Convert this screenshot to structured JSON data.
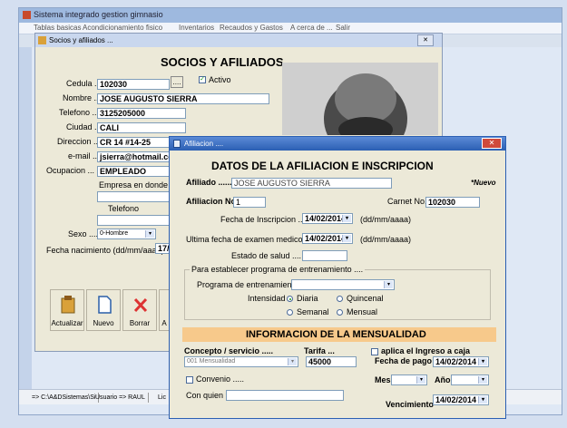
{
  "main_window": {
    "title": "Sistema integrado gestion gimnasio",
    "menu": [
      "Tablas basicas",
      "Acondicionamiento fisico",
      "Inventarios",
      "Recaudos y Gastos",
      "A cerca de ...",
      "Salir"
    ],
    "status": [
      "=> C:\\A&DSistemas\\Si",
      "Usuario => RAUL",
      "Lic"
    ]
  },
  "socios": {
    "title": "Socios y afiliados ...",
    "heading": "SOCIOS Y AFILIADOS",
    "labels": {
      "cedula": "Cedula ...",
      "nombre": "Nombre ...",
      "telefono": "Telefono ...",
      "ciudad": "Ciudad ...",
      "direccion": "Direccion ...",
      "email": "e-mail ...",
      "ocupacion": "Ocupacion ...",
      "empresa": "Empresa en donde labor",
      "telefono2": "Telefono",
      "sexo": "Sexo ....",
      "fecha_nac": "Fecha nacimiento (dd/mm/aaaa)",
      "activo": "Activo",
      "ellipsis": "...."
    },
    "values": {
      "cedula": "102030",
      "nombre": "JOSE AUGUSTO SIERRA",
      "telefono": "3125205000",
      "ciudad": "CALI",
      "direccion": "CR 14 #14-25",
      "email": "jsierra@hotmail.co",
      "ocupacion": "EMPLEADO",
      "sexo": "0-Hombre",
      "fecha_nac": "17/"
    },
    "toolbar": [
      "Actualizar",
      "Nuevo",
      "Borrar",
      "A"
    ]
  },
  "afiliacion": {
    "title": "Afiliacion ....",
    "heading": "DATOS DE LA AFILIACION E INSCRIPCION",
    "afiliado_label": "Afiliado ......",
    "afiliado_value": "JOSE AUGUSTO SIERRA",
    "nuevo": "*Nuevo",
    "afiliacion_no_label": "Afiliacion No.",
    "afiliacion_no_value": "1",
    "carnet_label": "Carnet No.",
    "carnet_value": "102030",
    "fecha_insc_label": "Fecha de Inscripcion .....",
    "fecha_insc_value": "14/02/2014",
    "fecha_format": "(dd/mm/aaaa)",
    "ultima_label": "Ultima fecha de examen medico ...",
    "ultima_value": "14/02/2014",
    "estado_label": "Estado de salud ....",
    "programa_group": "Para establecer programa de entrenamiento ....",
    "programa_label": "Programa de entrenamiento ....",
    "intensidad_label": "Intensidad ..",
    "radio_diaria": "Diaria",
    "radio_quincenal": "Quincenal",
    "radio_semanal": "Semanal",
    "radio_mensual": "Mensual",
    "mensualidad_heading": "INFORMACION DE LA MENSUALIDAD",
    "concepto_label": "Concepto / servicio .....",
    "concepto_value": "001 Mensualidad",
    "tarifa_label": "Tarifa ...",
    "tarifa_value": "45000",
    "aplica_label": "aplica el Ingreso a caja",
    "fecha_pago_label": "Fecha de pago",
    "fecha_pago_value": "14/02/2014",
    "convenio_label": "Convenio .....",
    "mes_label": "Mes",
    "anio_label": "Año",
    "con_quien_label": "Con quien ?",
    "vencimiento_label": "Vencimiento",
    "vencimiento_value": "14/02/2014"
  },
  "colors": {
    "desktop": "#d7e3f2",
    "title_blue": "#2b5fb3",
    "dialog_bg": "#ece9d8",
    "orange_band": "#f7c98b",
    "close_red": "#cf4a3c"
  }
}
